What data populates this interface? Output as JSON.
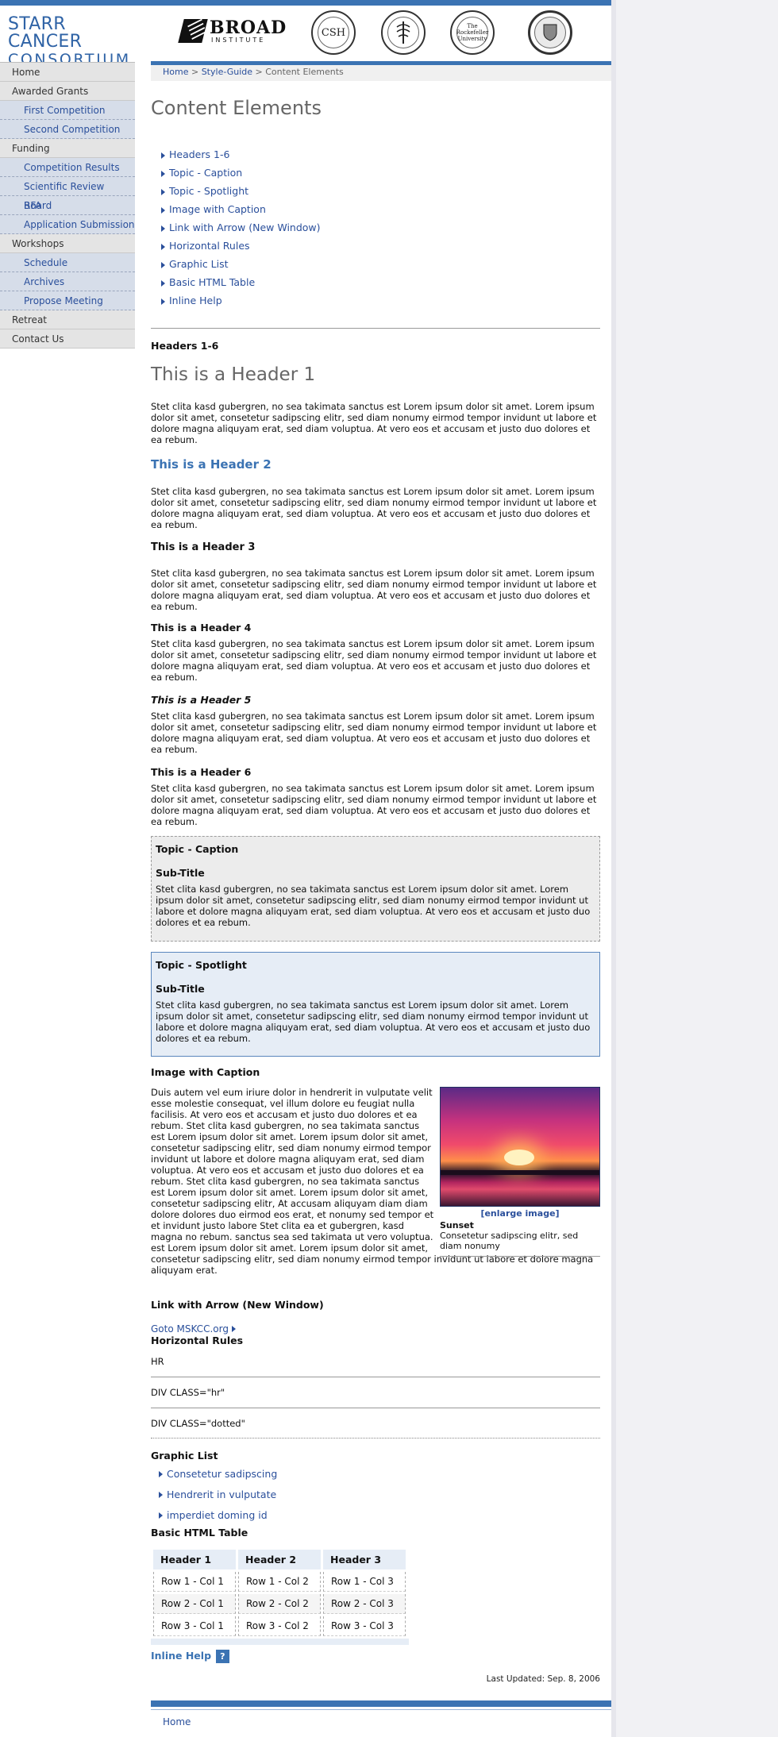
{
  "brand": {
    "line1": "STARR CANCER",
    "line2": "CONSORTIUM"
  },
  "partners": {
    "broad": {
      "name": "BROAD",
      "sub": "INSTITUTE"
    },
    "csh": {
      "abbr": "CSH"
    },
    "msk": {
      "abbr": "MSKCC"
    },
    "rockefeller": {
      "name": "The Rockefeller University"
    },
    "cornell": {
      "name": "Weill Cornell"
    }
  },
  "sidebar": {
    "items": [
      {
        "label": "Home",
        "sub": false
      },
      {
        "label": "Awarded Grants",
        "sub": false
      },
      {
        "label": "First Competition",
        "sub": true
      },
      {
        "label": "Second Competition",
        "sub": true
      },
      {
        "label": "Funding",
        "sub": false
      },
      {
        "label": "Competition Results",
        "sub": true
      },
      {
        "label": "Scientific Review Board",
        "sub": true
      },
      {
        "label": "RFA",
        "sub": true
      },
      {
        "label": "Application Submission",
        "sub": true
      },
      {
        "label": "Workshops",
        "sub": false
      },
      {
        "label": "Schedule",
        "sub": true
      },
      {
        "label": "Archives",
        "sub": true
      },
      {
        "label": "Propose Meeting",
        "sub": true
      },
      {
        "label": "Retreat",
        "sub": false
      },
      {
        "label": "Contact Us",
        "sub": false
      }
    ]
  },
  "breadcrumb": {
    "home": "Home",
    "sep1": " > ",
    "styleguide": "Style-Guide",
    "current": " > Content Elements"
  },
  "page": {
    "title": "Content Elements"
  },
  "toc": [
    "Headers 1-6",
    "Topic - Caption",
    "Topic - Spotlight",
    "Image with Caption",
    "Link with Arrow (New Window)",
    "Horizontal Rules",
    "Graphic List",
    "Basic HTML Table",
    "Inline Help"
  ],
  "headers": {
    "section": "Headers 1-6",
    "h1": "This is a Header 1",
    "h2": "This is a Header 2",
    "h3": "This is a Header 3",
    "h4": "This is a Header 4",
    "h5": "This is a Header 5",
    "h6": "This is a Header 6"
  },
  "lorem": "Stet clita kasd gubergren, no sea takimata sanctus est Lorem ipsum dolor sit amet. Lorem ipsum dolor sit amet, consetetur sadipscing elitr, sed diam nonumy eirmod tempor invidunt ut labore et dolore magna aliquyam erat, sed diam voluptua. At vero eos et accusam et justo duo dolores et ea rebum.",
  "caption": {
    "title": "Topic - Caption",
    "subtitle": "Sub-Title"
  },
  "spotlight": {
    "title": "Topic - Spotlight",
    "subtitle": "Sub-Title"
  },
  "image_section": {
    "title": "Image with Caption",
    "text": "Duis autem vel eum iriure dolor in hendrerit in vulputate velit esse molestie consequat, vel illum dolore eu feugiat nulla facilisis. At vero eos et accusam et justo duo dolores et ea rebum. Stet clita kasd gubergren, no sea takimata sanctus est Lorem ipsum dolor sit amet. Lorem ipsum dolor sit amet, consetetur sadipscing elitr, sed diam nonumy eirmod tempor invidunt ut labore et dolore magna aliquyam erat, sed diam voluptua. At vero eos et accusam et justo duo dolores et ea rebum. Stet clita kasd gubergren, no sea takimata sanctus est Lorem ipsum dolor sit amet. Lorem ipsum dolor sit amet, consetetur sadipscing elitr, At accusam aliquyam diam diam dolore dolores duo eirmod eos erat, et nonumy sed tempor et et invidunt justo labore Stet clita ea et gubergren, kasd magna no rebum. sanctus sea sed takimata ut vero voluptua. est Lorem ipsum dolor sit amet. Lorem ipsum dolor sit amet, consetetur sadipscing elitr, sed diam nonumy eirmod tempor invidunt ut labore et dolore magna aliquyam erat.",
    "enlarge": "[enlarge image]",
    "fig_title": "Sunset",
    "fig_desc": "Consetetur sadipscing elitr, sed diam nonumy"
  },
  "link_section": {
    "title": "Link with Arrow (New Window)",
    "link": "Goto MSKCC.org"
  },
  "hr_section": {
    "title": "Horizontal Rules",
    "hr": "HR",
    "div_hr": "DIV CLASS=\"hr\"",
    "div_dotted": "DIV CLASS=\"dotted\""
  },
  "graphic_list": {
    "title": "Graphic List",
    "items": [
      "Consetetur sadipscing",
      "Hendrerit in vulputate",
      "imperdiet doming id"
    ]
  },
  "table": {
    "title": "Basic HTML Table",
    "headers": [
      "Header 1",
      "Header 2",
      "Header 3"
    ],
    "rows": [
      [
        "Row 1 - Col 1",
        "Row 1 - Col 2",
        "Row 1 - Col 3"
      ],
      [
        "Row 2 - Col 1",
        "Row 2 - Col 2",
        "Row 2 - Col 3"
      ],
      [
        "Row 3 - Col 1",
        "Row 3 - Col 2",
        "Row 3 - Col 3"
      ]
    ]
  },
  "inline_help": {
    "label": "Inline Help",
    "icon": "?"
  },
  "updated": "Last Updated: Sep. 8, 2006",
  "footer": {
    "home": "Home"
  }
}
